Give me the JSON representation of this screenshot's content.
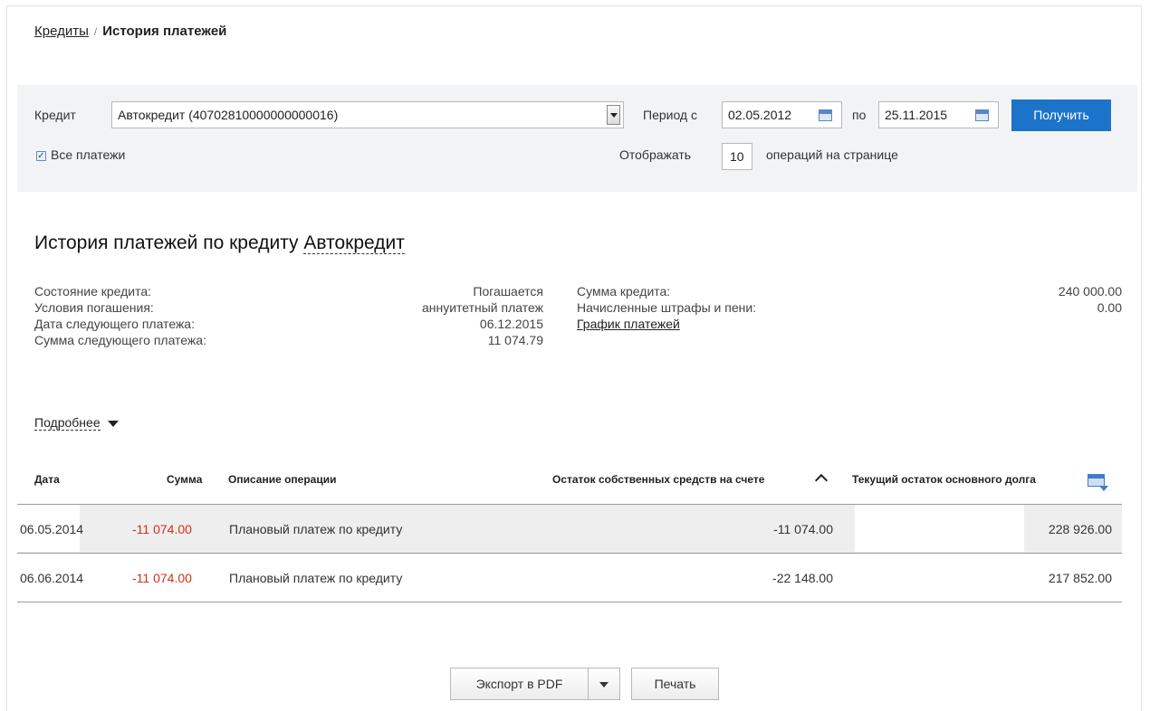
{
  "breadcrumb": {
    "parent": "Кредиты",
    "separator": "/",
    "current": "История платежей"
  },
  "filter": {
    "credit_label": "Кредит",
    "credit_value": "Автокредит (40702810000000000016)",
    "period_from_label": "Период с",
    "date_from": "02.05.2012",
    "period_to_label": "по",
    "date_to": "25.11.2015",
    "get_button": "Получить",
    "all_payments_label": "Все платежи",
    "all_payments_checked": true,
    "show_label": "Отображать",
    "per_page": "10",
    "per_page_suffix": "операций на странице"
  },
  "heading": {
    "prefix": "История платежей по кредиту",
    "name": "Автокредит"
  },
  "info": {
    "left": [
      {
        "label": "Состояние кредита:",
        "value": "Погашается"
      },
      {
        "label": "Условия погашения:",
        "value": "аннуитетный платеж"
      },
      {
        "label": "Дата следующего платежа:",
        "value": "06.12.2015"
      },
      {
        "label": "Сумма следующего платежа:",
        "value": "11 074.79"
      }
    ],
    "right": [
      {
        "label": "Сумма кредита:",
        "value": "240 000.00"
      },
      {
        "label": "Начисленные штрафы и пени:",
        "value": "0.00"
      }
    ],
    "schedule_link": "График платежей"
  },
  "more_label": "Подробнее",
  "table": {
    "headers": {
      "date": "Дата",
      "sum": "Сумма",
      "description": "Описание операции",
      "own_funds": "Остаток собственных средств на счете",
      "debt": "Текущий остаток основного долга"
    },
    "rows": [
      {
        "date": "06.05.2014",
        "sum": "-11 074.00",
        "description": "Плановый платеж по кредиту",
        "own_funds": "-11 074.00",
        "debt": "228 926.00"
      },
      {
        "date": "06.06.2014",
        "sum": "-11 074.00",
        "description": "Плановый платеж по кредиту",
        "own_funds": "-22 148.00",
        "debt": "217 852.00"
      }
    ]
  },
  "actions": {
    "export_pdf": "Экспорт в PDF",
    "print": "Печать"
  },
  "colors": {
    "primary_button": "#1b74c9",
    "negative_amount": "#d0311b",
    "filter_background": "#f2f3f5"
  },
  "icons": [
    "calendar-icon",
    "dropdown-arrow-icon",
    "sort-up-icon",
    "columns-settings-icon",
    "chevron-down-icon"
  ]
}
